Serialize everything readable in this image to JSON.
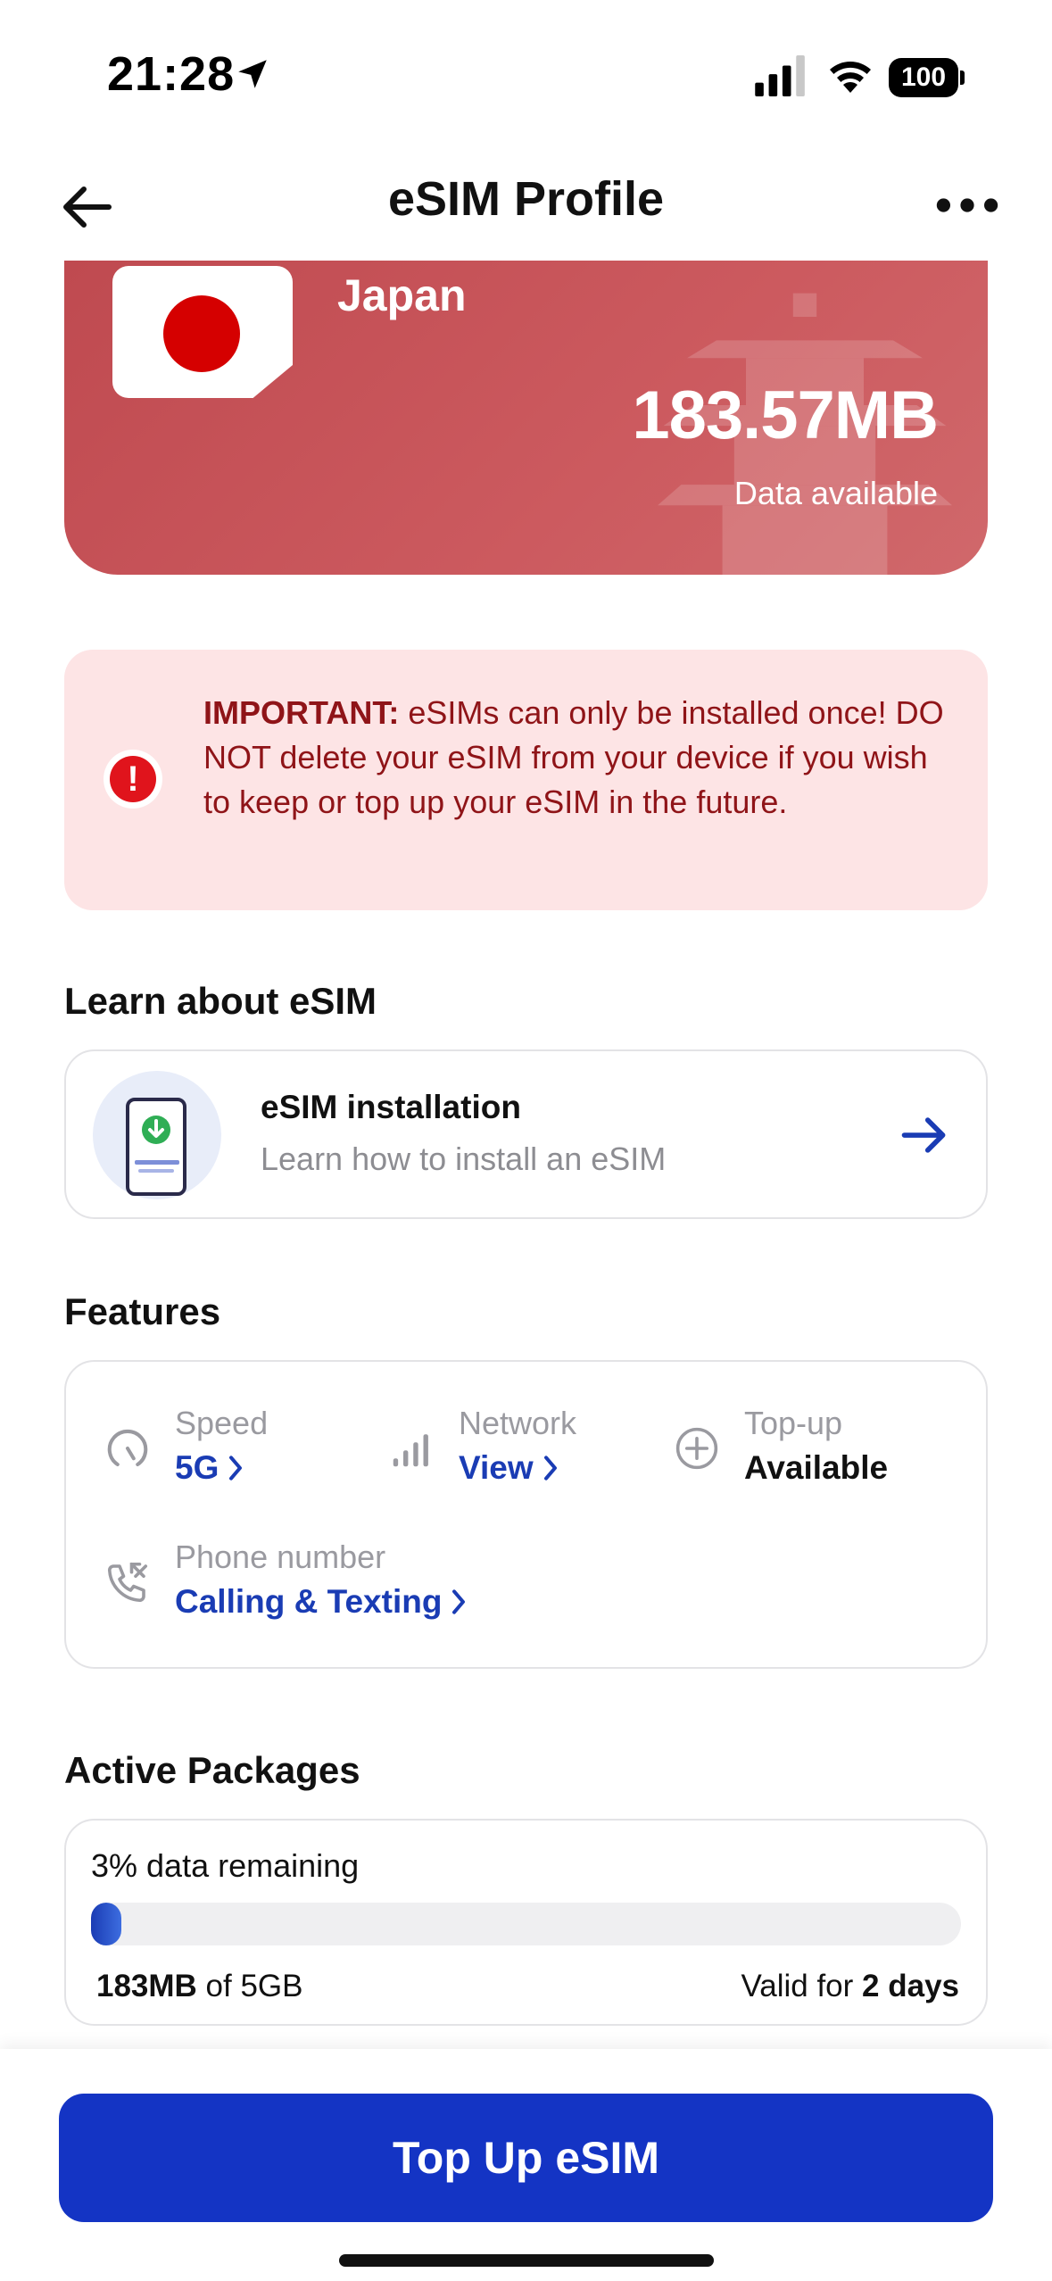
{
  "status_bar": {
    "time": "21:28",
    "battery": "100",
    "icons": [
      "location-arrow-icon",
      "cellular-signal-icon",
      "wifi-icon",
      "battery-icon"
    ]
  },
  "nav": {
    "title": "eSIM Profile",
    "back_icon": "arrow-left-icon",
    "more_icon": "more-horizontal-icon"
  },
  "hero": {
    "country": "Japan",
    "data_amount": "183.57MB",
    "data_caption": "Data available",
    "flag_icon": "japan-flag-icon",
    "background_color": "#c65257"
  },
  "important": {
    "label": "IMPORTANT:",
    "message": " eSIMs can only be installed once! DO NOT delete your eSIM from your device if you wish to keep or top up your eSIM in the future.",
    "icon": "alert-circle-icon"
  },
  "learn": {
    "heading": "Learn about eSIM",
    "card": {
      "title": "eSIM installation",
      "subtitle": "Learn how to install an eSIM",
      "icon": "phone-download-icon",
      "arrow_icon": "arrow-right-icon"
    }
  },
  "features": {
    "heading": "Features",
    "items": [
      {
        "label": "Speed",
        "value": "5G",
        "icon": "speedometer-icon",
        "link": true
      },
      {
        "label": "Network",
        "value": "View",
        "icon": "signal-bars-icon",
        "link": true
      },
      {
        "label": "Top-up",
        "value": "Available",
        "icon": "plus-circle-icon",
        "link": false
      },
      {
        "label": "Phone number",
        "value": "Calling & Texting",
        "icon": "phone-call-icon",
        "link": true
      }
    ]
  },
  "packages": {
    "heading": "Active Packages",
    "remaining_text": "3% data remaining",
    "remaining_fraction": 0.03,
    "used": "183MB",
    "of_text": " of 5GB",
    "valid_prefix": "Valid for ",
    "valid_value": "2 days"
  },
  "actions": {
    "topup_label": "Top Up eSIM"
  },
  "colors": {
    "accent": "#1434c4",
    "link": "#1a3cb4",
    "alert": "#e0141c",
    "alert_bg": "#fde4e5"
  }
}
